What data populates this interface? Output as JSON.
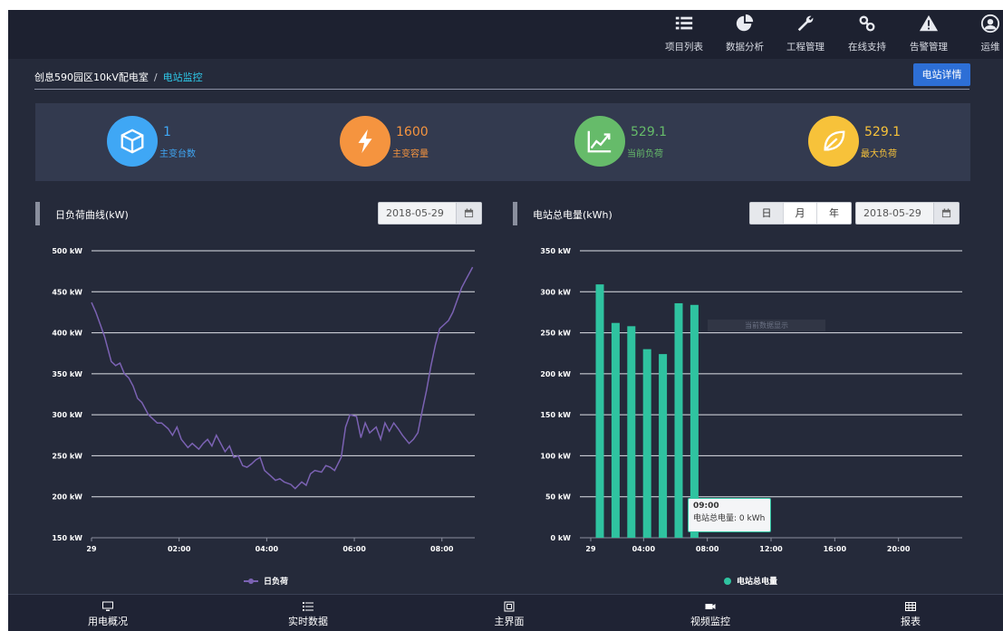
{
  "nav": {
    "items": [
      {
        "label": "项目列表",
        "icon": "list-icon"
      },
      {
        "label": "数据分析",
        "icon": "pie-chart-icon"
      },
      {
        "label": "工程管理",
        "icon": "wrench-icon"
      },
      {
        "label": "在线支持",
        "icon": "link-icon"
      },
      {
        "label": "告警管理",
        "icon": "warning-icon"
      },
      {
        "label": "运维",
        "icon": "user-icon"
      }
    ]
  },
  "breadcrumb": {
    "parent": "创息590园区10kV配电室",
    "separator": "/",
    "current": "电站监控"
  },
  "detail_button": "电站详情",
  "stats": [
    {
      "value": "1",
      "label": "主变台数",
      "icon": "cube-icon",
      "color": "#3fa7f5"
    },
    {
      "value": "1600",
      "label": "主变容量",
      "icon": "lightning-icon",
      "color": "#f5943f"
    },
    {
      "value": "529.1",
      "label": "当前负荷",
      "icon": "trend-chart-icon",
      "color": "#66bb6a"
    },
    {
      "value": "529.1",
      "label": "最大负荷",
      "icon": "leaf-icon",
      "color": "#f7c23a"
    }
  ],
  "load_panel": {
    "title": "日负荷曲线(kW)",
    "date": "2018-05-29"
  },
  "energy_panel": {
    "title": "电站总电量(kWh)",
    "seg_buttons": [
      "日",
      "月",
      "年"
    ],
    "date": "2018-05-29"
  },
  "tooltip": {
    "time": "09:00",
    "text": "电站总电量: 0 kWh"
  },
  "ghost_text": "当前数据显示",
  "bottom_nav": [
    {
      "label": "用电概况",
      "icon": "monitor-icon"
    },
    {
      "label": "实时数据",
      "icon": "list-icon"
    },
    {
      "label": "主界面",
      "icon": "frame-icon"
    },
    {
      "label": "视频监控",
      "icon": "video-icon"
    },
    {
      "label": "报表",
      "icon": "table-icon"
    }
  ],
  "chart_data": [
    {
      "type": "line",
      "title": "日负荷曲线(kW)",
      "ylim": [
        150,
        500
      ],
      "y_ticks": [
        "150 kW",
        "200 kW",
        "250 kW",
        "300 kW",
        "350 kW",
        "400 kW",
        "450 kW",
        "500 kW"
      ],
      "x_ticks": [
        "29",
        "02:00",
        "04:00",
        "06:00",
        "08:00"
      ],
      "x_range_hours": [
        0,
        8.75
      ],
      "grid": true,
      "legend": "bottom-center",
      "color": "#7b62b3",
      "series": [
        {
          "name": "日负荷",
          "x": [
            0,
            0.1,
            0.2,
            0.3,
            0.45,
            0.55,
            0.65,
            0.75,
            0.85,
            0.95,
            1.05,
            1.15,
            1.3,
            1.4,
            1.5,
            1.6,
            1.75,
            1.85,
            1.95,
            2.05,
            2.2,
            2.3,
            2.45,
            2.55,
            2.65,
            2.75,
            2.85,
            2.95,
            3.05,
            3.15,
            3.25,
            3.35,
            3.45,
            3.55,
            3.65,
            3.75,
            3.85,
            3.95,
            4.1,
            4.2,
            4.3,
            4.4,
            4.55,
            4.65,
            4.8,
            4.9,
            5.0,
            5.1,
            5.25,
            5.35,
            5.45,
            5.55,
            5.7,
            5.8,
            5.9,
            6.05,
            6.15,
            6.25,
            6.35,
            6.5,
            6.6,
            6.7,
            6.8,
            6.9,
            7.0,
            7.1,
            7.25,
            7.35,
            7.45,
            7.55,
            7.65,
            7.75,
            7.85,
            7.95,
            8.05,
            8.15,
            8.25,
            8.35,
            8.45,
            8.55,
            8.65,
            8.7
          ],
          "values": [
            437,
            425,
            410,
            395,
            365,
            360,
            363,
            350,
            345,
            335,
            320,
            315,
            300,
            295,
            290,
            290,
            283,
            275,
            285,
            270,
            260,
            265,
            258,
            265,
            270,
            262,
            275,
            265,
            255,
            262,
            248,
            250,
            238,
            236,
            240,
            245,
            248,
            232,
            225,
            220,
            222,
            218,
            215,
            210,
            218,
            214,
            228,
            232,
            230,
            238,
            236,
            232,
            248,
            285,
            300,
            298,
            272,
            290,
            278,
            285,
            270,
            290,
            280,
            290,
            283,
            275,
            265,
            270,
            278,
            305,
            330,
            360,
            385,
            405,
            410,
            415,
            425,
            440,
            455,
            465,
            475,
            480
          ]
        }
      ]
    },
    {
      "type": "bar",
      "title": "电站总电量(kWh)",
      "ylim": [
        0,
        350
      ],
      "y_ticks": [
        "0 kW",
        "50 kW",
        "100 kW",
        "150 kW",
        "200 kW",
        "250 kW",
        "300 kW",
        "350 kW"
      ],
      "x_ticks": [
        "29",
        "04:00",
        "08:00",
        "12:00",
        "16:00",
        "20:00"
      ],
      "categories": [
        "00:00",
        "01:00",
        "02:00",
        "03:00",
        "04:00",
        "05:00",
        "06:00",
        "07:00"
      ],
      "grid": true,
      "legend": "bottom-center",
      "color": "#2fc3a0",
      "series": [
        {
          "name": "电站总电量",
          "values": [
            309,
            262,
            258,
            230,
            224,
            286,
            284,
            0
          ]
        }
      ]
    }
  ]
}
